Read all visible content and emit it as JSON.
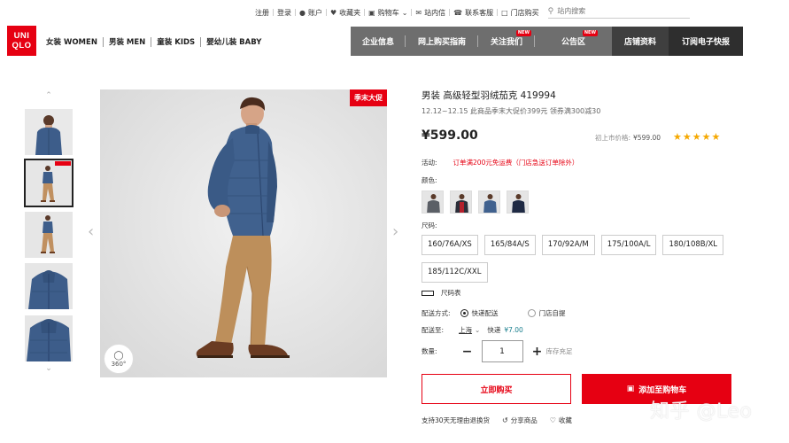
{
  "utility_bar": {
    "register": "注册",
    "login": "登录",
    "account": "账户",
    "favorites": "收藏夹",
    "cart": "购物车",
    "messages": "站内信",
    "contact": "联系客服",
    "store_pickup": "门店购买",
    "search_placeholder": "站内搜索"
  },
  "logo": {
    "line1": "UNI",
    "line2": "QLO"
  },
  "category_nav": [
    {
      "label": "女装 WOMEN"
    },
    {
      "label": "男装 MEN"
    },
    {
      "label": "童装 KIDS"
    },
    {
      "label": "婴幼儿装 BABY"
    }
  ],
  "tabs": [
    {
      "label": "企业信息",
      "new": ""
    },
    {
      "label": "网上购买指南",
      "new": ""
    },
    {
      "label": "关注我们",
      "new": "NEW"
    },
    {
      "label": "公告区",
      "new": "NEW"
    },
    {
      "label": "店铺资料",
      "new": ""
    },
    {
      "label": "订阅电子快报",
      "new": ""
    }
  ],
  "product": {
    "promo_badge": "季末大促",
    "view360": "360°",
    "title": "男装 高级轻型羽绒茄克 419994",
    "subtitle": "12.12~12.15 此商品季末大促价399元 领券满300减30",
    "price": "¥599.00",
    "first_price_label": "初上市价格:",
    "first_price": "¥599.00",
    "stars": "★★★★★",
    "rating": 5,
    "promo_label": "活动:",
    "promo_value": "订单满200元免运费（门店急送订单除外）",
    "color_label": "颜色:",
    "size_label": "尺码:",
    "sizes": [
      "160/76A/XS",
      "165/84A/S",
      "170/92A/M",
      "175/100A/L",
      "180/108B/XL",
      "185/112C/XXL"
    ],
    "size_chart": "尺码表",
    "shipping_label": "配送方式:",
    "shipping_express": "快递配送",
    "shipping_store": "门店自提",
    "dest_label": "配送至:",
    "dest_city": "上海",
    "dest_method": "快递",
    "dest_fee": "¥7.00",
    "qty_label": "数量:",
    "qty_value": "1",
    "stock": "库存充足",
    "buy_now": "立即购买",
    "add_cart": "添加至购物车",
    "return_policy": "支持30天无理由退换货",
    "share": "分享商品",
    "favorite": "收藏"
  },
  "watermark": "知乎 @Leo",
  "colors": {
    "brand_red": "#e60012",
    "tab_grey": "#6e6e6e",
    "tab_dark": "#3f3f3f"
  }
}
